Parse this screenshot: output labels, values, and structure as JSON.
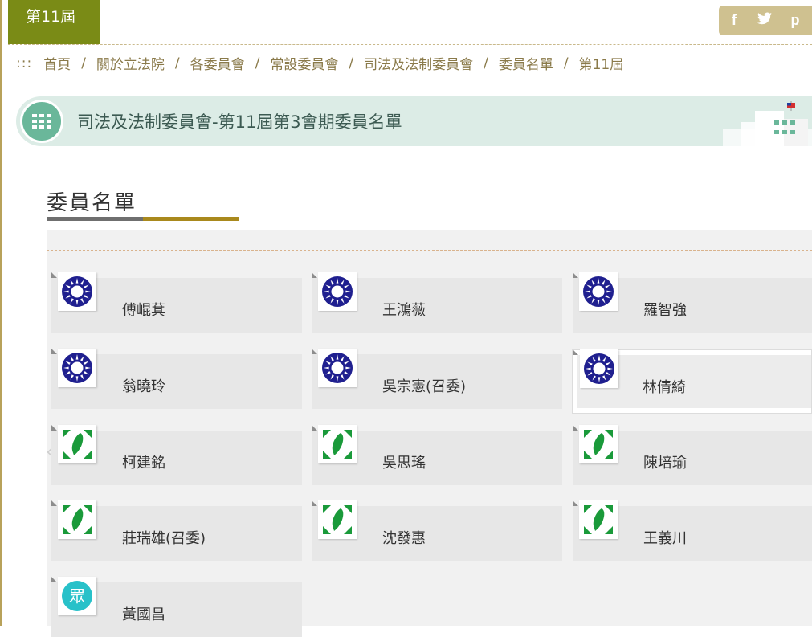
{
  "header": {
    "term_tab": "第11屆",
    "social": [
      {
        "icon": "facebook-icon",
        "glyph": "f"
      },
      {
        "icon": "twitter-icon",
        "glyph": "t"
      },
      {
        "icon": "plurk-icon",
        "glyph": "p"
      }
    ]
  },
  "breadcrumb": {
    "lead": ":::",
    "items": [
      "首頁",
      "關於立法院",
      "各委員會",
      "常設委員會",
      "司法及法制委員會",
      "委員名單",
      "第11屆"
    ],
    "separator": "/"
  },
  "banner": {
    "title": "司法及法制委員會-第11屆第3會期委員名單"
  },
  "section": {
    "title": "委員名單"
  },
  "members": [
    {
      "name": "傅崐萁",
      "party": "kmt"
    },
    {
      "name": "王鴻薇",
      "party": "kmt"
    },
    {
      "name": "羅智強",
      "party": "kmt"
    },
    {
      "name": "翁曉玲",
      "party": "kmt"
    },
    {
      "name": "吳宗憲(召委)",
      "party": "kmt"
    },
    {
      "name": "林倩綺",
      "party": "kmt"
    },
    {
      "name": "柯建銘",
      "party": "dpp"
    },
    {
      "name": "吳思瑤",
      "party": "dpp"
    },
    {
      "name": "陳培瑜",
      "party": "dpp"
    },
    {
      "name": "莊瑞雄(召委)",
      "party": "dpp"
    },
    {
      "name": "沈發惠",
      "party": "dpp"
    },
    {
      "name": "王義川",
      "party": "dpp"
    },
    {
      "name": "黃國昌",
      "party": "tpp"
    }
  ],
  "party_logos": {
    "kmt": {
      "icon": "kmt-emblem-icon"
    },
    "dpp": {
      "icon": "dpp-emblem-icon"
    },
    "tpp": {
      "icon": "tpp-emblem-icon",
      "text": "眾"
    }
  },
  "colors": {
    "term_tab": "#7a8b16",
    "banner_bg": "#dcece6",
    "banner_icon": "#6ab79a",
    "title_underline_gold": "#a9891d",
    "kmt_blue": "#1f1f8f",
    "dpp_green": "#1a9a3a",
    "tpp_teal": "#28c1c9"
  }
}
